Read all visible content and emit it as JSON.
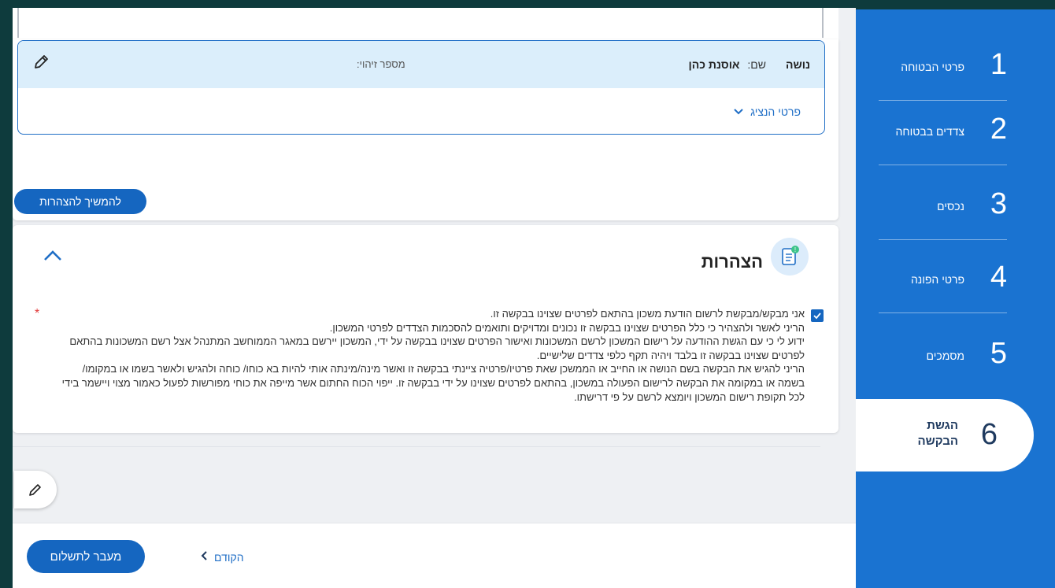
{
  "holder": {
    "role": "נושה",
    "name_label": "שם:",
    "name_value": "אוסנת כהן",
    "id_label": "מספר זיהוי:",
    "representative_toggle": "פרטי הנציג"
  },
  "buttons": {
    "continue_declarations": "להמשיך להצהרות",
    "go_to_payment": "מעבר לתשלום",
    "previous": "הקודם"
  },
  "declarations": {
    "title": "הצהרות",
    "badge": "!",
    "required_mark": "*",
    "paragraphs": [
      "אני מבקש/מבקשת לרשום הודעת משכון בהתאם לפרטים שצוינו בבקשה זו.",
      "הריני לאשר ולהצהיר כי כלל הפרטים שצוינו בבקשה זו נכונים ומדויקים ותואמים להסכמות הצדדים לפרטי המשכון.",
      "ידוע לי כי עם הגשת ההודעה על רישום המשכון לרשם המשכונות ואישור הפרטים שצוינו בבקשה על ידי, המשכון יירשם במאגר הממוחשב המתנהל אצל רשם המשכונות בהתאם לפרטים שצוינו בבקשה זו בלבד ויהיה תקף כלפי צדדים שלישיים.",
      "הריני להגיש את הבקשה בשם הנושה או החייב או הממשכן שאת פרטיו/פרטיה ציינתי בבקשה זו ואשר מינה/מינתה אותי להיות בא כוחו/ כוחה ולהגיש ולאשר בשמו או במקומו/ בשמה או במקומה את הבקשה לרישום הפעולה במשכון, בהתאם לפרטים שצוינו על ידי בבקשה זו. ייפוי הכוח החתום אשר מייפה את כוחי מפורשות לפעול כאמור מצוי ויישמר בידי לכל תקופת רישום המשכון ויומצא לרשם על פי דרישתו."
    ]
  },
  "steps": [
    {
      "number": "1",
      "label": "פרטי הבטוחה"
    },
    {
      "number": "2",
      "label": "צדדים בבטוחה"
    },
    {
      "number": "3",
      "label": "נכסים"
    },
    {
      "number": "4",
      "label": "פרטי הפונה"
    },
    {
      "number": "5",
      "label": "מסמכים"
    },
    {
      "number": "6",
      "label": "הגשת הבקשה"
    }
  ],
  "icons": {
    "edit": "pencil-icon",
    "document": "document-icon",
    "collapse": "chevron-up-icon",
    "expand": "chevron-down-icon",
    "prev": "chevron-left-icon",
    "check": "check-icon"
  },
  "colors": {
    "primary": "#1566c0",
    "sidebar": "#1a73d1",
    "highlight_row": "#dbeefb",
    "required": "#e23b3b"
  }
}
